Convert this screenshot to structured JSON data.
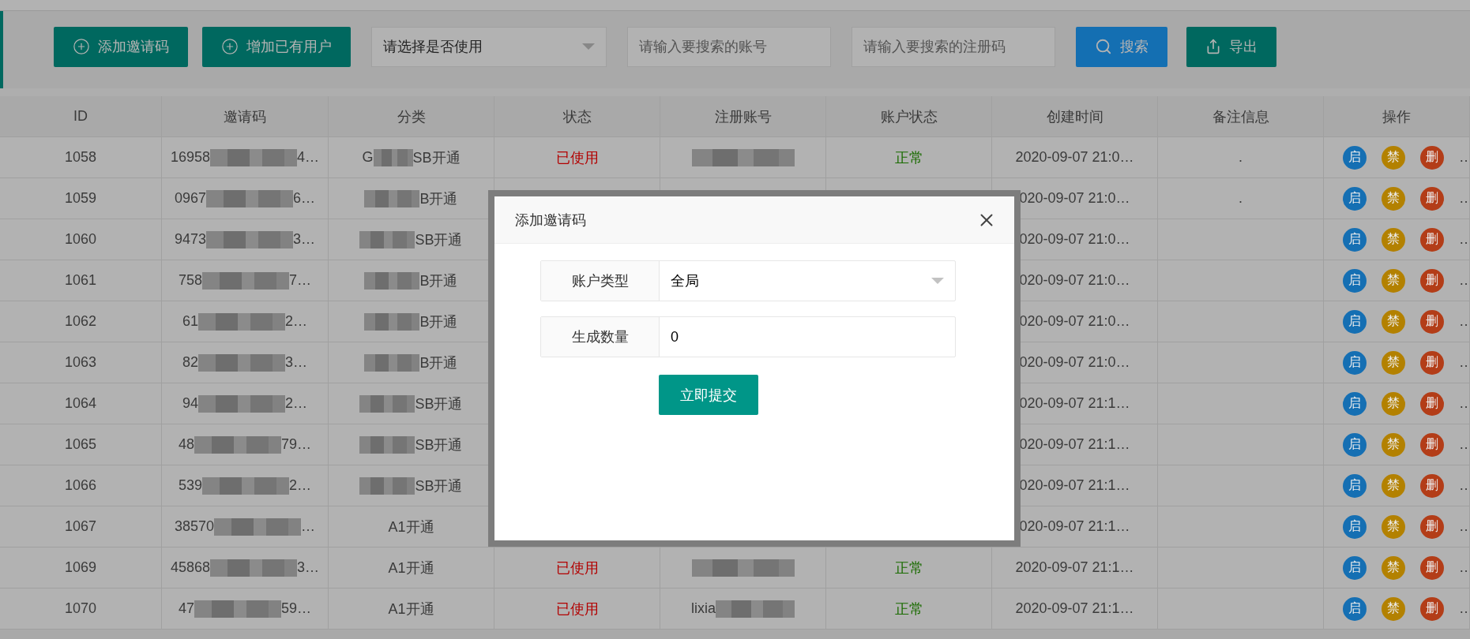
{
  "toolbar": {
    "buttons": [
      {
        "label": "添加邀请码",
        "kind": "add"
      },
      {
        "label": "增加已有用户",
        "kind": "add"
      }
    ],
    "filter_select": {
      "value": "请选择是否使用"
    },
    "search_fields": [
      {
        "placeholder": "请输入要搜索的账号"
      },
      {
        "placeholder": "请输入要搜索的注册码"
      }
    ],
    "actions": [
      {
        "label": "搜索",
        "kind": "search"
      },
      {
        "label": "导出",
        "kind": "export"
      }
    ]
  },
  "table": {
    "columns": [
      "ID",
      "邀请码",
      "分类",
      "状态",
      "注册账号",
      "账户状态",
      "创建时间",
      "备注信息",
      "操作"
    ],
    "rows": [
      {
        "id": "1058",
        "code": {
          "head": "16958",
          "tail": "4…"
        },
        "category": {
          "head": "G",
          "tail": "SB开通",
          "masked": true
        },
        "status": "已使用",
        "account": {
          "masked": true
        },
        "account_status": "正常",
        "created": "2020-09-07 21:0…",
        "remark": ".",
        "actions": [
          {
            "label": "启",
            "color": "#156fb3"
          },
          {
            "label": "禁",
            "color": "#b38100"
          },
          {
            "label": "删",
            "color": "#b33d18"
          }
        ],
        "more": "…"
      },
      {
        "id": "1059",
        "code": {
          "head": "0967",
          "tail": "6…"
        },
        "category": {
          "tail": "B开通",
          "masked": true
        },
        "created": "020-09-07 21:0…",
        "remark": ".",
        "actions": [
          {
            "label": "启",
            "color": "#156fb3"
          },
          {
            "label": "禁",
            "color": "#b38100"
          },
          {
            "label": "删",
            "color": "#b33d18"
          }
        ],
        "more": "…"
      },
      {
        "id": "1060",
        "code": {
          "head": "9473",
          "tail": "3…"
        },
        "category": {
          "tail": "SB开通",
          "masked": true
        },
        "created": "020-09-07 21:0…",
        "actions": [
          {
            "label": "启",
            "color": "#156fb3"
          },
          {
            "label": "禁",
            "color": "#b38100"
          },
          {
            "label": "删",
            "color": "#b33d18"
          }
        ],
        "more": "…"
      },
      {
        "id": "1061",
        "code": {
          "head": "758",
          "tail": "7…"
        },
        "category": {
          "tail": "B开通",
          "masked": true
        },
        "created": "020-09-07 21:0…",
        "actions": [
          {
            "label": "启",
            "color": "#156fb3"
          },
          {
            "label": "禁",
            "color": "#b38100"
          },
          {
            "label": "删",
            "color": "#b33d18"
          }
        ],
        "more": "…"
      },
      {
        "id": "1062",
        "code": {
          "head": "61",
          "tail": "2…"
        },
        "category": {
          "tail": "B开通",
          "masked": true
        },
        "created": "020-09-07 21:0…",
        "actions": [
          {
            "label": "启",
            "color": "#156fb3"
          },
          {
            "label": "禁",
            "color": "#b38100"
          },
          {
            "label": "删",
            "color": "#b33d18"
          }
        ],
        "more": "…"
      },
      {
        "id": "1063",
        "code": {
          "head": "82",
          "tail": "3…"
        },
        "category": {
          "tail": "B开通",
          "masked": true
        },
        "created": "020-09-07 21:0…",
        "actions": [
          {
            "label": "启",
            "color": "#156fb3"
          },
          {
            "label": "禁",
            "color": "#b38100"
          },
          {
            "label": "删",
            "color": "#b33d18"
          }
        ],
        "more": "…"
      },
      {
        "id": "1064",
        "code": {
          "head": "94",
          "tail": "2…"
        },
        "category": {
          "tail": "SB开通",
          "masked": true
        },
        "created": "020-09-07 21:1…",
        "actions": [
          {
            "label": "启",
            "color": "#156fb3"
          },
          {
            "label": "禁",
            "color": "#b38100"
          },
          {
            "label": "删",
            "color": "#b33d18"
          }
        ],
        "more": "…"
      },
      {
        "id": "1065",
        "code": {
          "head": "48",
          "tail": "79…"
        },
        "category": {
          "tail": "SB开通",
          "masked": true
        },
        "created": "020-09-07 21:1…",
        "actions": [
          {
            "label": "启",
            "color": "#156fb3"
          },
          {
            "label": "禁",
            "color": "#b38100"
          },
          {
            "label": "删",
            "color": "#b33d18"
          }
        ],
        "more": "…"
      },
      {
        "id": "1066",
        "code": {
          "head": "539",
          "tail": "2…"
        },
        "category": {
          "tail": "SB开通",
          "masked": true
        },
        "created": "020-09-07 21:1…",
        "actions": [
          {
            "label": "启",
            "color": "#156fb3"
          },
          {
            "label": "禁",
            "color": "#b38100"
          },
          {
            "label": "删",
            "color": "#b33d18"
          }
        ],
        "more": "…"
      },
      {
        "id": "1067",
        "code": {
          "head": "38570",
          "tail": "…"
        },
        "category": {
          "tail": "A1开通",
          "masked": false
        },
        "created": "020-09-07 21:1…",
        "actions": [
          {
            "label": "启",
            "color": "#156fb3"
          },
          {
            "label": "禁",
            "color": "#b38100"
          },
          {
            "label": "删",
            "color": "#b33d18"
          }
        ],
        "more": "…"
      },
      {
        "id": "1069",
        "code": {
          "head": "45868",
          "tail": "3…"
        },
        "category": {
          "tail": "A1开通",
          "masked": false
        },
        "status": "已使用",
        "account": {
          "masked": true
        },
        "account_status": "正常",
        "created": "2020-09-07 21:1…",
        "actions": [
          {
            "label": "启",
            "color": "#156fb3"
          },
          {
            "label": "禁",
            "color": "#b38100"
          },
          {
            "label": "删",
            "color": "#b33d18"
          }
        ],
        "more": "…"
      },
      {
        "id": "1070",
        "code": {
          "head": "47",
          "tail": "59…"
        },
        "category": {
          "tail": "A1开通",
          "masked": false
        },
        "status": "已使用",
        "account": {
          "head": "lixia",
          "masked": true
        },
        "account_status": "正常",
        "created": "2020-09-07 21:1…",
        "actions": [
          {
            "label": "启",
            "color": "#156fb3"
          },
          {
            "label": "禁",
            "color": "#b38100"
          },
          {
            "label": "删",
            "color": "#b33d18"
          }
        ],
        "more": "…"
      }
    ]
  },
  "dialog": {
    "title": "添加邀请码",
    "fields": [
      {
        "label": "账户类型",
        "value": "全局",
        "kind": "select"
      },
      {
        "label": "生成数量",
        "value": "0",
        "kind": "input"
      }
    ],
    "submit": "立即提交"
  }
}
